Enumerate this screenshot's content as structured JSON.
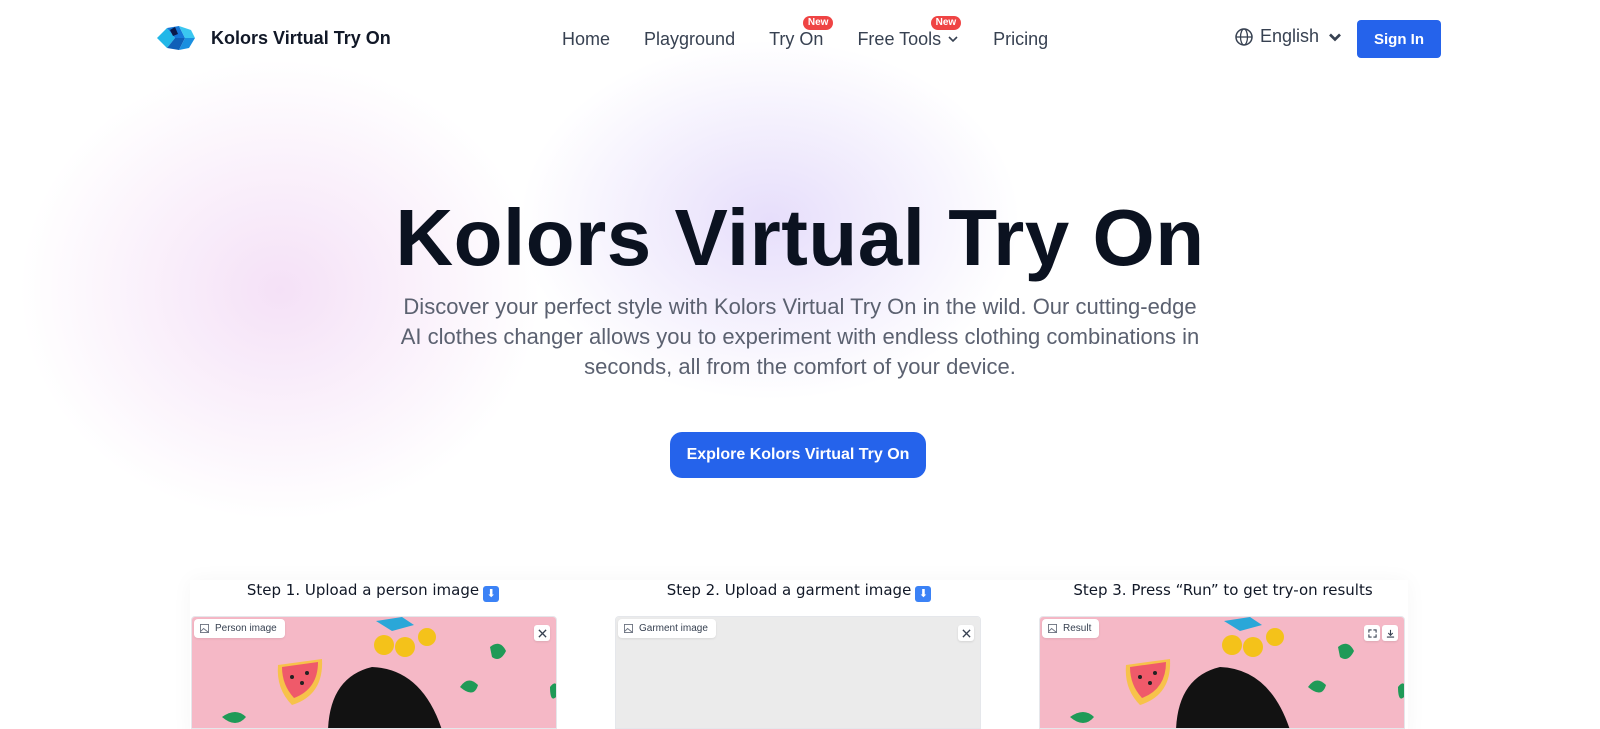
{
  "header": {
    "brand": "Kolors Virtual Try On",
    "nav": [
      {
        "label": "Home",
        "badge": ""
      },
      {
        "label": "Playground",
        "badge": ""
      },
      {
        "label": "Try On",
        "badge": "New"
      },
      {
        "label": "Free Tools",
        "badge": "New",
        "dropdown": true
      },
      {
        "label": "Pricing",
        "badge": ""
      }
    ],
    "language": "English",
    "sign_in": "Sign In"
  },
  "hero": {
    "title": "Kolors Virtual Try On",
    "subtitle": "Discover your perfect style with Kolors Virtual Try On in the wild. Our cutting-edge AI clothes changer allows you to experiment with endless clothing combinations in seconds, all from the comfort of your device.",
    "cta": "Explore Kolors Virtual Try On"
  },
  "steps": [
    {
      "title": "Step 1. Upload a person image",
      "card_label": "Person image"
    },
    {
      "title": "Step 2. Upload a garment image",
      "card_label": "Garment image"
    },
    {
      "title": "Step 3. Press “Run” to get try-on results",
      "card_label": "Result"
    }
  ],
  "colors": {
    "accent": "#2563eb",
    "badge": "#ef4444",
    "photo_bg": "#f5b8c6"
  }
}
